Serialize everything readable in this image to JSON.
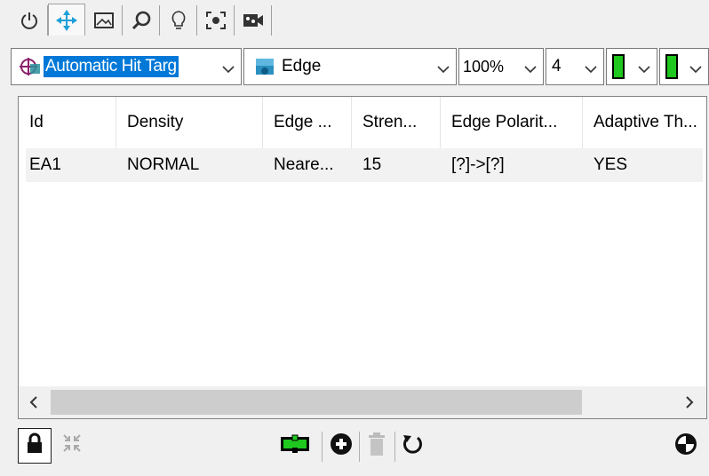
{
  "tabs": [
    {
      "icon": "power-icon"
    },
    {
      "icon": "move-arrows-icon",
      "active": true
    },
    {
      "icon": "image-icon"
    },
    {
      "icon": "zoom-search-icon"
    },
    {
      "icon": "lightbulb-icon"
    },
    {
      "icon": "focus-target-icon"
    },
    {
      "icon": "camera-video-icon"
    }
  ],
  "toolbar": {
    "target_combo": {
      "value": "Automatic Hit Targ",
      "icon": "hit-target-icon"
    },
    "tool_combo": {
      "value": "Edge",
      "icon": "edge-tool-icon"
    },
    "zoom_combo": {
      "value": "100%"
    },
    "count_combo": {
      "value": "4"
    },
    "color1_combo": {
      "icon": "green-bar-icon"
    },
    "color2_combo": {
      "icon": "green-bar-icon"
    }
  },
  "grid": {
    "columns": [
      "Id",
      "Density",
      "Edge ...",
      "Stren...",
      "Edge Polarit...",
      "Adaptive Th..."
    ],
    "rows": [
      [
        "EA1",
        "NORMAL",
        "Neare...",
        "15",
        "[?]->[?]",
        "YES"
      ]
    ],
    "scroll_left": "<",
    "scroll_right": ">"
  },
  "bottom": {
    "lock": "lock-icon",
    "fit": "collapse-arrows-icon",
    "tool": "green-tool-icon",
    "add": "add-icon",
    "delete": "trash-icon",
    "reset": "rotate-icon",
    "options": "circle-quadrant-icon"
  },
  "colors": {
    "selection": "#0078d7",
    "accent_blue": "#1aa0d8",
    "green": "#1ec81e"
  }
}
